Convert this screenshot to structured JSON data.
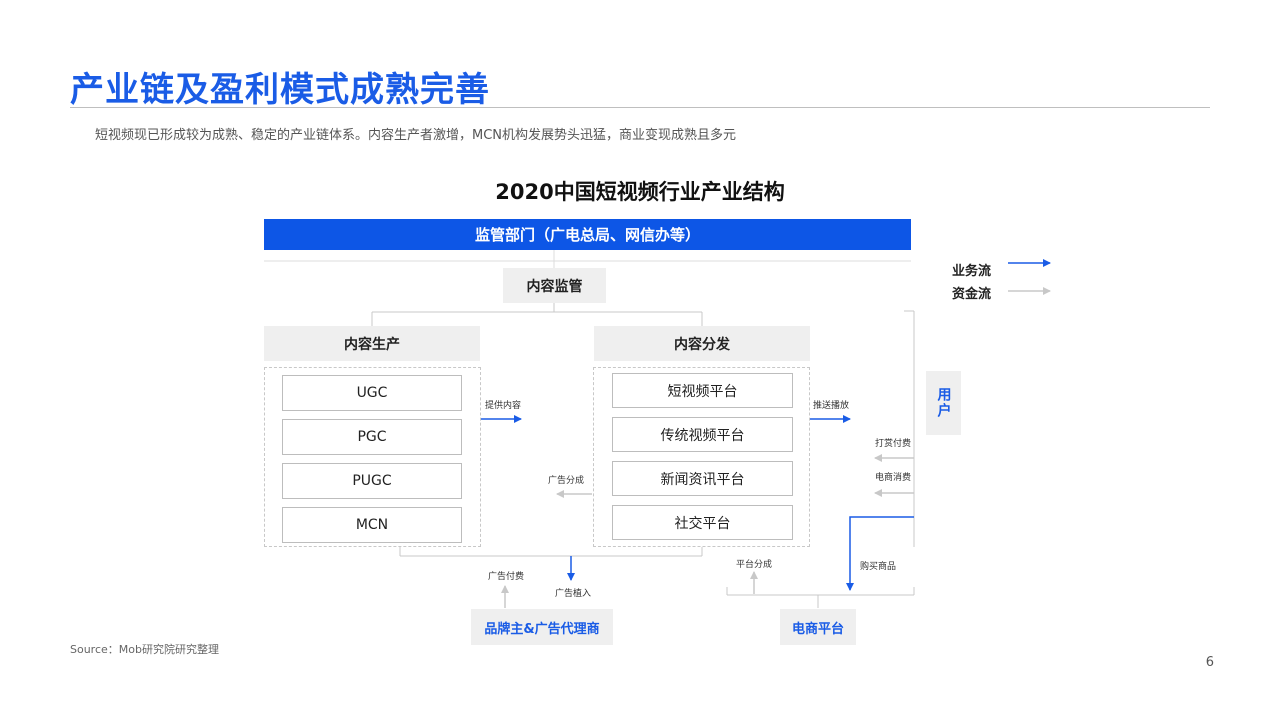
{
  "slide": {
    "title": "产业链及盈利模式成熟完善",
    "subtitle": "短视频现已形成较为成熟、稳定的产业链体系。内容生产者激增，MCN机构发展势头迅猛，商业变现成熟且多元",
    "source": "Source：Mob研究院研究整理",
    "page_number": "6"
  },
  "diagram": {
    "title": "2020中国短视频行业产业结构",
    "regulator": "监管部门（广电总局、网信办等）",
    "supervision": "内容监管",
    "production": {
      "header": "内容生产",
      "items": [
        "UGC",
        "PGC",
        "PUGC",
        "MCN"
      ]
    },
    "distribution": {
      "header": "内容分发",
      "items": [
        "短视频平台",
        "传统视频平台",
        "新闻资讯平台",
        "社交平台"
      ]
    },
    "user": "用户",
    "advertiser": "品牌主&广告代理商",
    "ecommerce": "电商平台",
    "edge_labels": {
      "provide_content": "提供内容",
      "push_play": "推送播放",
      "ad_share": "广告分成",
      "tip_pay": "打赏付费",
      "ecom_consume": "电商消费",
      "ad_pay": "广告付费",
      "ad_placement": "广告植入",
      "platform_share": "平台分成",
      "buy_goods": "购买商品"
    },
    "legend": {
      "business_flow": "业务流",
      "money_flow": "资金流"
    },
    "colors": {
      "business_flow": "#1a5ce6",
      "money_flow": "#c8c8c8",
      "accent": "#0d56e6"
    }
  }
}
